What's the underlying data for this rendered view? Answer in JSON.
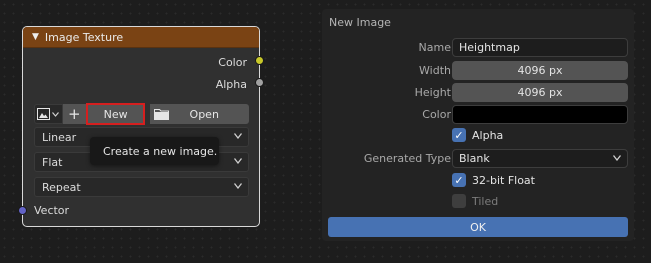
{
  "node": {
    "title": "Image Texture",
    "outputs": {
      "color": "Color",
      "alpha": "Alpha"
    },
    "new_button": "New",
    "open_button": "Open",
    "interpolation": "Linear",
    "projection": "Flat",
    "extension": "Repeat",
    "input_vector": "Vector",
    "tooltip": "Create a new image.",
    "plus_glyph": "+",
    "icons": {
      "collapse": "chevron-down-icon",
      "image": "image-icon",
      "folder": "folder-icon",
      "dropdown": "chevron-down-icon"
    },
    "socket_colors": {
      "color": "#c7c729",
      "alpha": "#a1a1a1",
      "vector": "#6363c7"
    },
    "header_color": "#7a4314"
  },
  "dialog": {
    "title": "New Image",
    "name_label": "Name",
    "name_value": "Heightmap",
    "width_label": "Width",
    "width_value": "4096 px",
    "height_label": "Height",
    "height_value": "4096 px",
    "color_label": "Color",
    "color_value": "#000000",
    "alpha_label": "Alpha",
    "alpha_checked": true,
    "generated_type_label": "Generated Type",
    "generated_type_value": "Blank",
    "float_label": "32-bit Float",
    "float_checked": true,
    "tiled_label": "Tiled",
    "tiled_checked": false,
    "ok_label": "OK",
    "accent_color": "#4772b3"
  }
}
